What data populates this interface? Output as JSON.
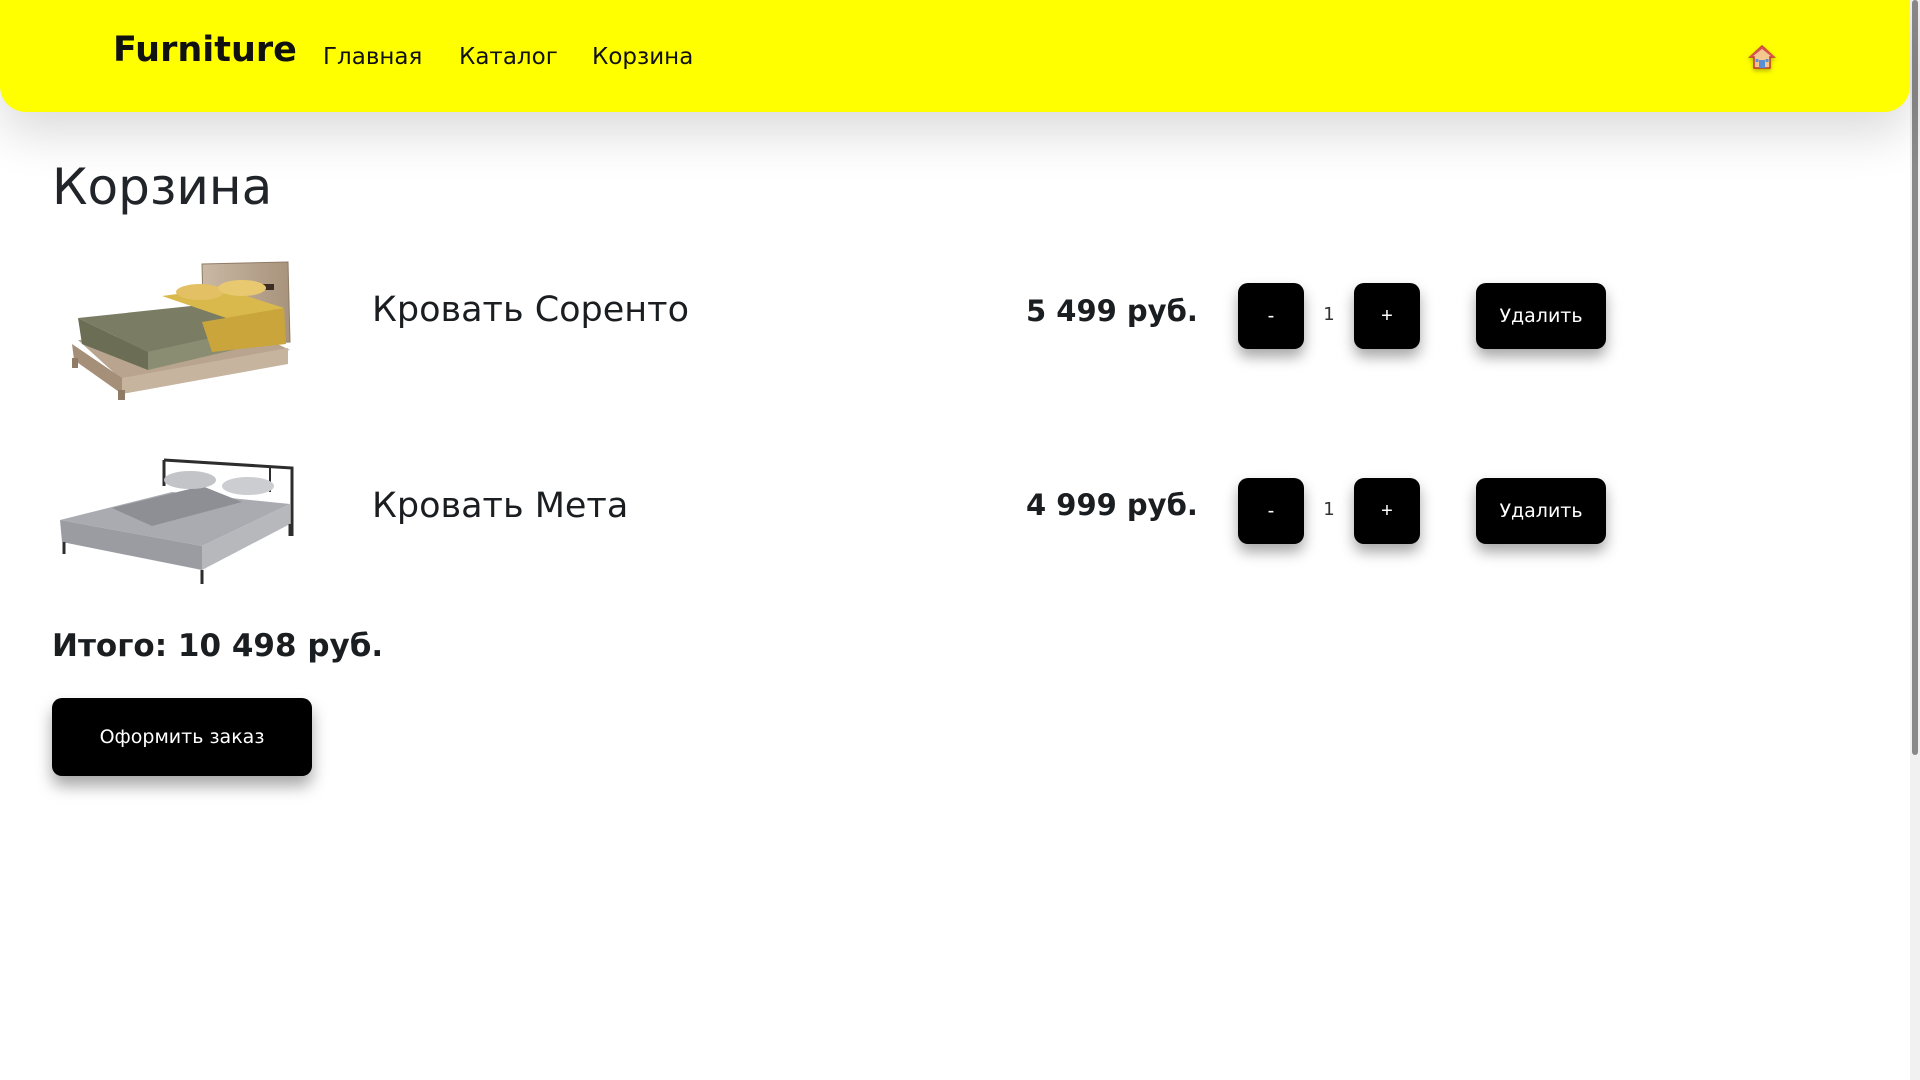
{
  "navbar": {
    "brand": "Furniture",
    "links": [
      "Главная",
      "Каталог",
      "Корзина"
    ],
    "home_icon": "home-icon"
  },
  "page_title": "Корзина",
  "cart": {
    "items": [
      {
        "name": "Кровать Соренто",
        "price": "5 499 руб.",
        "quantity": "1",
        "decrement_label": "-",
        "increment_label": "+",
        "remove_label": "Удалить",
        "image": "bed-sorento-image"
      },
      {
        "name": "Кровать Мета",
        "price": "4 999 руб.",
        "quantity": "1",
        "decrement_label": "-",
        "increment_label": "+",
        "remove_label": "Удалить",
        "image": "bed-meta-image"
      }
    ],
    "total": "Итого: 10 498 руб.",
    "checkout_label": "Оформить заказ"
  },
  "colors": {
    "navbar_bg": "#ffff00",
    "button_bg": "#000000",
    "button_text": "#ffffff",
    "text": "#1b1e21"
  }
}
